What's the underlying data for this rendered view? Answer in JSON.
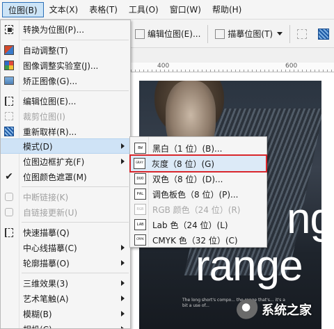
{
  "menubar": {
    "items": [
      {
        "label": "位图(B)",
        "active": true
      },
      {
        "label": "文本(X)"
      },
      {
        "label": "表格(T)"
      },
      {
        "label": "工具(O)"
      },
      {
        "label": "窗口(W)"
      },
      {
        "label": "帮助(H)"
      }
    ]
  },
  "toolbar": {
    "edit_bitmap": "编辑位图(E)...",
    "trace_bitmap": "描摹位图(T)"
  },
  "ruler": {
    "tick_400": "400",
    "tick_600": "600"
  },
  "canvas": {
    "big_text_1": "ng",
    "big_text_2": "range",
    "caption": "The long short's compo... the range that's... it's a bit a use of... "
  },
  "watermark": {
    "text": "系统之家"
  },
  "bitmap_menu": {
    "items": [
      {
        "label": "转换为位图(P)...",
        "icon": "convert-bitmap-icon"
      },
      {
        "label": "自动调整(T)",
        "icon": "auto-adjust-icon"
      },
      {
        "label": "图像调整实验室(J)...",
        "icon": "image-lab-icon"
      },
      {
        "label": "矫正图像(G)...",
        "icon": "straighten-icon"
      },
      {
        "label": "编辑位图(E)...",
        "icon": "edit-bitmap-icon"
      },
      {
        "label": "裁剪位图(I)",
        "icon": "crop-bitmap-icon",
        "disabled": true
      },
      {
        "label": "重新取样(R)...",
        "icon": "resample-icon"
      },
      {
        "label": "模式(D)",
        "submenu": true,
        "selected": true
      },
      {
        "label": "位图边框扩充(F)",
        "submenu": true
      },
      {
        "label": "位图颜色遮罩(M)",
        "icon": "check-icon"
      },
      {
        "label": "中断链接(K)",
        "icon": "break-link-icon",
        "disabled": true
      },
      {
        "label": "自链接更新(U)",
        "icon": "update-link-icon",
        "disabled": true
      },
      {
        "label": "快速描摹(Q)",
        "icon": "quick-trace-icon"
      },
      {
        "label": "中心线描摹(C)",
        "submenu": true
      },
      {
        "label": "轮廓描摹(O)",
        "submenu": true
      },
      {
        "label": "三维效果(3)",
        "submenu": true
      },
      {
        "label": "艺术笔触(A)",
        "submenu": true
      },
      {
        "label": "模糊(B)",
        "submenu": true
      },
      {
        "label": "相机(C)",
        "submenu": true
      }
    ]
  },
  "mode_submenu": {
    "items": [
      {
        "label": "黑白（1 位）(B)...",
        "badge": "BW"
      },
      {
        "label": "灰度（8 位）(G)",
        "badge": "GRAY",
        "highlight": true
      },
      {
        "label": "双色（8 位）(D)...",
        "badge": "DUO"
      },
      {
        "label": "调色板色（8 位）(P)...",
        "badge": "PAL"
      },
      {
        "label": "RGB 颜色（24 位）(R)",
        "badge": "RGB",
        "disabled": true
      },
      {
        "label": "Lab 色（24 位）(L)",
        "badge": "LAB"
      },
      {
        "label": "CMYK 色（32 位）(C)",
        "badge": "CMYK"
      }
    ]
  },
  "colors": {
    "highlight_border": "#d9262b",
    "selected_bg": "#cfe3f6"
  }
}
